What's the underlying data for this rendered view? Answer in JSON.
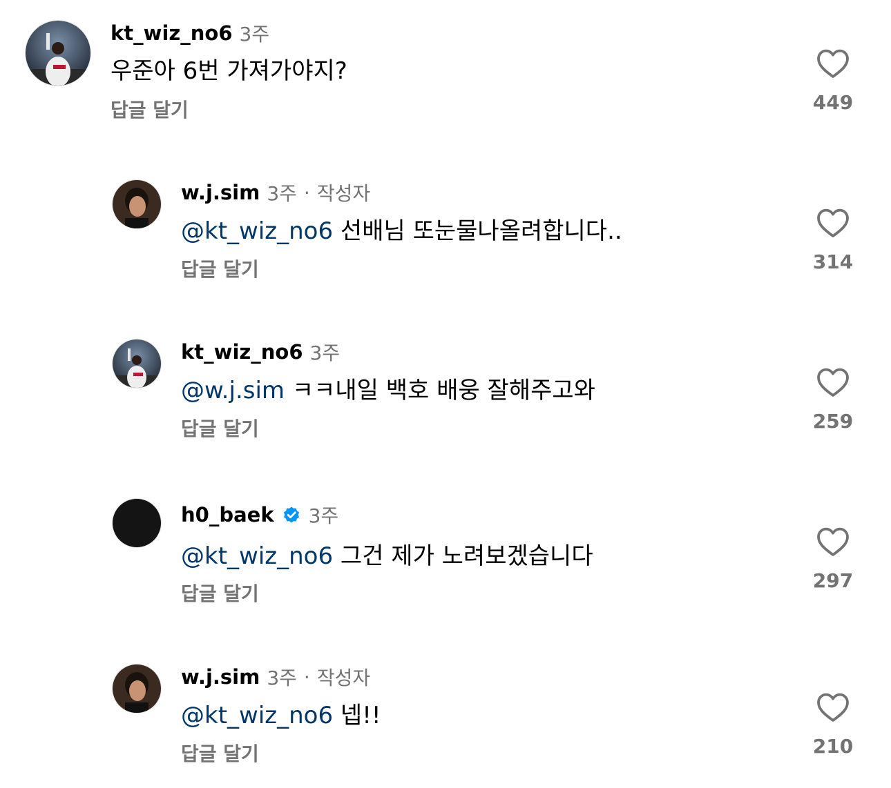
{
  "reply_label": "답글 달기",
  "colors": {
    "text": "#000000",
    "secondary": "#737373",
    "mention": "#00376b",
    "verified": "#0095f6"
  },
  "comments": [
    {
      "username": "kt_wiz_no6",
      "time": "3주",
      "mention": "",
      "body": "우준아 6번 가져가야지?",
      "likes": "449"
    },
    {
      "username": "w.j.sim",
      "time": "3주",
      "author_tag": "작성자",
      "mention": "@kt_wiz_no6",
      "body": "선배님 또눈물나올려합니다..",
      "likes": "314"
    },
    {
      "username": "kt_wiz_no6",
      "time": "3주",
      "mention": "@w.j.sim",
      "body": "ㅋㅋ내일 백호 배웅 잘해주고와",
      "likes": "259"
    },
    {
      "username": "h0_baek",
      "verified": true,
      "time": "3주",
      "mention": "@kt_wiz_no6",
      "body": "그건 제가 노려보겠습니다",
      "likes": "297"
    },
    {
      "username": "w.j.sim",
      "time": "3주",
      "author_tag": "작성자",
      "mention": "@kt_wiz_no6",
      "body": "넵!!",
      "likes": "210"
    }
  ]
}
